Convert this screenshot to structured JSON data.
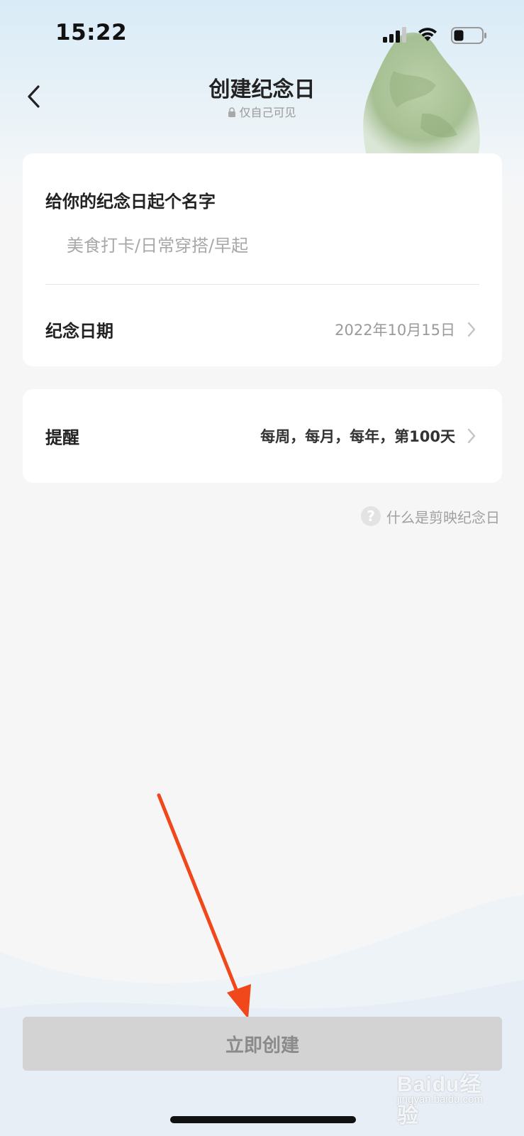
{
  "status_bar": {
    "time": "15:22"
  },
  "nav": {
    "title": "创建纪念日",
    "visibility_note": "仅自己可见"
  },
  "form": {
    "name_label": "给你的纪念日起个名字",
    "name_placeholder": "美食打卡/日常穿搭/早起",
    "name_value": "",
    "date_label": "纪念日期",
    "date_value": "2022年10月15日",
    "reminder_label": "提醒",
    "reminder_value": "每周，每月，每年，第100天"
  },
  "help": {
    "icon_glyph": "?",
    "label": "什么是剪映纪念日"
  },
  "create_button": {
    "label": "立即创建"
  },
  "watermark": {
    "brand": "Baidu经验",
    "site": "jingyan.baidu.com"
  },
  "colors": {
    "annotation_arrow": "#f0481a",
    "button_disabled_bg": "#d3d3d3",
    "page_bg": "#f6f6f6"
  }
}
